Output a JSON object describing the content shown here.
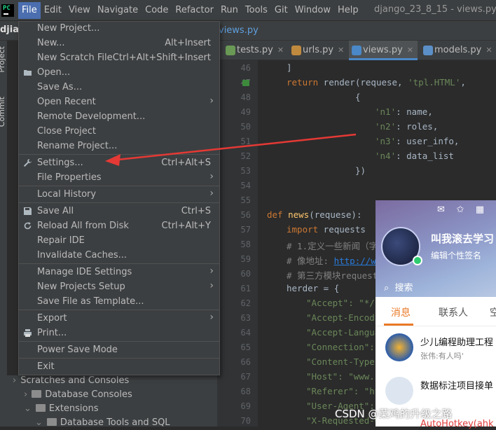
{
  "menubar": {
    "logo": "PC",
    "items": [
      "File",
      "Edit",
      "View",
      "Navigate",
      "Code",
      "Refactor",
      "Run",
      "Tools",
      "Git",
      "Window",
      "Help"
    ],
    "project_title": "django_23_8_15 - views.py"
  },
  "nav": {
    "project": "djiango",
    "file": "views.py"
  },
  "tool_window": {
    "project_tab": "Project",
    "commit_tab": "Commit"
  },
  "editor_tabs": [
    {
      "label": "tests.py",
      "color": "#6a9955"
    },
    {
      "label": "urls.py",
      "color": "#c08a3e"
    },
    {
      "label": "views.py",
      "color": "#4a88c7"
    },
    {
      "label": "models.py",
      "color": "#5b8fc7"
    }
  ],
  "line_numbers": [
    "46",
    "47",
    "48",
    "49",
    "50",
    "51",
    "52",
    "53",
    "54",
    "55",
    "56",
    "57",
    "58",
    "59",
    "60",
    "61",
    "62",
    "63",
    "64",
    "65",
    "66",
    "67",
    "68",
    "69",
    "70"
  ],
  "code": {
    "l46": "]",
    "l47_kw": "return",
    "l47_rest": " render(requese, ",
    "l47_str": "'tpl.HTML'",
    "l47_end": ",",
    "l48": "{",
    "l49_key": "'n1'",
    "l49_val": ": name,",
    "l50_key": "'n2'",
    "l50_val": ": roles,",
    "l51_key": "'n3'",
    "l51_val": ": user_info,",
    "l52_key": "'n4'",
    "l52_val": ": data_list",
    "l53": "})",
    "l56_kw": "def",
    "l56_fn": "news",
    "l56_rest": "(requese):",
    "l57_kw": "import",
    "l57_rest": " requests",
    "l58": "# 1.定义一些新闻（字",
    "l59_pre": "# 像地址: ",
    "l59_url": "http://ww",
    "l60": "# 第三方模块request",
    "l61": "herder = {",
    "l62": "\"Accept\": \"*/*\"",
    "l63": "\"Accept-Encodi",
    "l64": "\"Accept-Langua",
    "l65": "\"Connection\": ",
    "l66": "\"Content-Type\"",
    "l67": "\"Host\": \"www.c",
    "l68": "\"Referer\": \"ht",
    "l69": "\"User-Agent\": ",
    "l70": "\"X-Requested-W"
  },
  "file_menu": {
    "items": [
      {
        "label": "New Project...",
        "shortcut": "",
        "submenu": false,
        "icon": ""
      },
      {
        "label": "New...",
        "shortcut": "Alt+Insert",
        "submenu": false,
        "icon": ""
      },
      {
        "label": "New Scratch File",
        "shortcut": "Ctrl+Alt+Shift+Insert",
        "submenu": false,
        "icon": ""
      },
      {
        "label": "Open...",
        "shortcut": "",
        "submenu": false,
        "icon": "folder-icon"
      },
      {
        "label": "Save As...",
        "shortcut": "",
        "submenu": false,
        "icon": ""
      },
      {
        "label": "Open Recent",
        "shortcut": "",
        "submenu": true,
        "icon": ""
      },
      {
        "label": "Remote Development...",
        "shortcut": "",
        "submenu": false,
        "icon": ""
      },
      {
        "label": "Close Project",
        "shortcut": "",
        "submenu": false,
        "icon": ""
      },
      {
        "label": "Rename Project...",
        "shortcut": "",
        "submenu": false,
        "icon": ""
      },
      {
        "label": "Settings...",
        "shortcut": "Ctrl+Alt+S",
        "submenu": false,
        "icon": "wrench-icon"
      },
      {
        "label": "File Properties",
        "shortcut": "",
        "submenu": true,
        "icon": ""
      },
      {
        "label": "Local History",
        "shortcut": "",
        "submenu": true,
        "icon": ""
      },
      {
        "label": "Save All",
        "shortcut": "Ctrl+S",
        "submenu": false,
        "icon": "save-icon"
      },
      {
        "label": "Reload All from Disk",
        "shortcut": "Ctrl+Alt+Y",
        "submenu": false,
        "icon": "reload-icon"
      },
      {
        "label": "Repair IDE",
        "shortcut": "",
        "submenu": false,
        "icon": ""
      },
      {
        "label": "Invalidate Caches...",
        "shortcut": "",
        "submenu": false,
        "icon": ""
      },
      {
        "label": "Manage IDE Settings",
        "shortcut": "",
        "submenu": true,
        "icon": ""
      },
      {
        "label": "New Projects Setup",
        "shortcut": "",
        "submenu": true,
        "icon": ""
      },
      {
        "label": "Save File as Template...",
        "shortcut": "",
        "submenu": false,
        "icon": ""
      },
      {
        "label": "Export",
        "shortcut": "",
        "submenu": true,
        "icon": ""
      },
      {
        "label": "Print...",
        "shortcut": "",
        "submenu": false,
        "icon": "print-icon"
      },
      {
        "label": "Power Save Mode",
        "shortcut": "",
        "submenu": false,
        "icon": ""
      },
      {
        "label": "Exit",
        "shortcut": "",
        "submenu": false,
        "icon": ""
      }
    ]
  },
  "project_tree": [
    {
      "label": "Scratches and Consoles"
    },
    {
      "label": "Database Consoles"
    },
    {
      "label": "Extensions"
    },
    {
      "label": "Database Tools and SQL"
    }
  ],
  "chat": {
    "name": "叫我滚去学习",
    "signature": "编辑个性签名",
    "search": "搜索",
    "tabs": [
      "消息",
      "联系人",
      "空"
    ],
    "items": [
      {
        "title": "少儿编程助理工程",
        "sub": "张伟:有人吗'"
      },
      {
        "title": "数据标注项目接单",
        "sub": ""
      }
    ]
  },
  "watermark": "CSDN @菜鸡的升级之路",
  "bottom_red": "AutoHotkey(ahk"
}
